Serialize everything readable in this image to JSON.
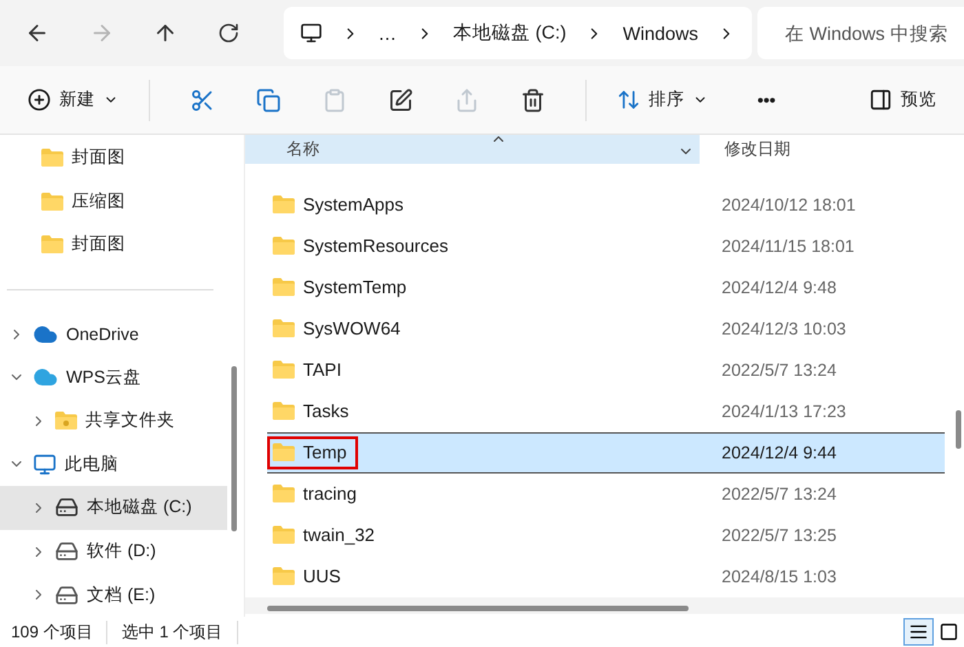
{
  "nav": {
    "back_enabled": true,
    "forward_enabled": false
  },
  "breadcrumb": [
    "…",
    "本地磁盘 (C:)",
    "Windows"
  ],
  "search": {
    "placeholder": "在 Windows 中搜索"
  },
  "toolbar": {
    "new_label": "新建",
    "sort_label": "排序",
    "more_label": "•••",
    "preview_label": "预览",
    "actions": [
      {
        "kind": "cut",
        "disabled": false
      },
      {
        "kind": "copy",
        "disabled": false
      },
      {
        "kind": "paste",
        "disabled": true
      },
      {
        "kind": "rename",
        "disabled": false
      },
      {
        "kind": "share",
        "disabled": true
      },
      {
        "kind": "delete",
        "disabled": false
      }
    ]
  },
  "quick_access": [
    {
      "label": "封面图"
    },
    {
      "label": "压缩图"
    },
    {
      "label": "封面图"
    }
  ],
  "tree": [
    {
      "label": "OneDrive",
      "kind": "cloud",
      "expanded": false,
      "selected": false
    },
    {
      "label": "WPS云盘",
      "kind": "wps",
      "expanded": true,
      "selected": false,
      "children": [
        {
          "label": "共享文件夹",
          "kind": "shared",
          "expanded": false,
          "selected": false
        }
      ]
    },
    {
      "label": "此电脑",
      "kind": "pc",
      "expanded": true,
      "selected": false,
      "children": [
        {
          "label": "本地磁盘 (C:)",
          "kind": "sysdrive",
          "expanded": false,
          "selected": true
        },
        {
          "label": "软件 (D:)",
          "kind": "drive",
          "expanded": false,
          "selected": false
        },
        {
          "label": "文档 (E:)",
          "kind": "drive",
          "expanded": false,
          "selected": false
        }
      ]
    }
  ],
  "table": {
    "columns": [
      "名称",
      "修改日期"
    ],
    "rows": [
      {
        "name": "SystemApps",
        "date": "2024/10/12 18:01",
        "selected": false,
        "highlighted": false
      },
      {
        "name": "SystemResources",
        "date": "2024/11/15 18:01",
        "selected": false,
        "highlighted": false
      },
      {
        "name": "SystemTemp",
        "date": "2024/12/4 9:48",
        "selected": false,
        "highlighted": false
      },
      {
        "name": "SysWOW64",
        "date": "2024/12/3 10:03",
        "selected": false,
        "highlighted": false
      },
      {
        "name": "TAPI",
        "date": "2022/5/7 13:24",
        "selected": false,
        "highlighted": false
      },
      {
        "name": "Tasks",
        "date": "2024/1/13 17:23",
        "selected": false,
        "highlighted": false
      },
      {
        "name": "Temp",
        "date": "2024/12/4 9:44",
        "selected": true,
        "highlighted": true
      },
      {
        "name": "tracing",
        "date": "2022/5/7 13:24",
        "selected": false,
        "highlighted": false
      },
      {
        "name": "twain_32",
        "date": "2022/5/7 13:25",
        "selected": false,
        "highlighted": false
      },
      {
        "name": "UUS",
        "date": "2024/8/15 1:03",
        "selected": false,
        "highlighted": false
      }
    ]
  },
  "status_bar": {
    "count": "109 个项目",
    "selection": "选中 1 个项目",
    "details_view": true
  }
}
